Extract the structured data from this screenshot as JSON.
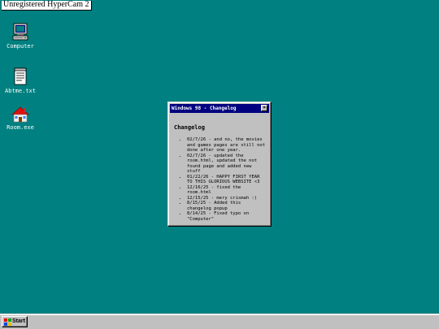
{
  "watermark": "Unregistered HyperCam 2",
  "desktop": {
    "icons": [
      {
        "label": "Computer",
        "icon": "computer-icon"
      },
      {
        "label": "Abtme.txt",
        "icon": "text-file-icon"
      },
      {
        "label": "Room.exe",
        "icon": "house-icon"
      }
    ]
  },
  "window": {
    "title": "Windows 98 - Changelog",
    "close_label": "×",
    "heading": "Changelog",
    "entries": [
      "02/7/26 - and no, the movies and games pages are still not done after one year.",
      "02/7/26 - updated the room.html, updated the not found page and added new stuff",
      "01/22/26 - HAPPY FIRST YEAR TO THIS GLORIOUS WEBSITE <3",
      "12/16/25 - fixed the room.html",
      "12/15/25 - mery crismah :)",
      "8/15/25 - Added this changelog popup",
      "8/14/25 - Fixed typo on \"Computer\""
    ]
  },
  "taskbar": {
    "start_label": "Start"
  },
  "colors": {
    "desktop": "#008080",
    "titlebar": "#000080",
    "chrome": "#c0c0c0"
  }
}
